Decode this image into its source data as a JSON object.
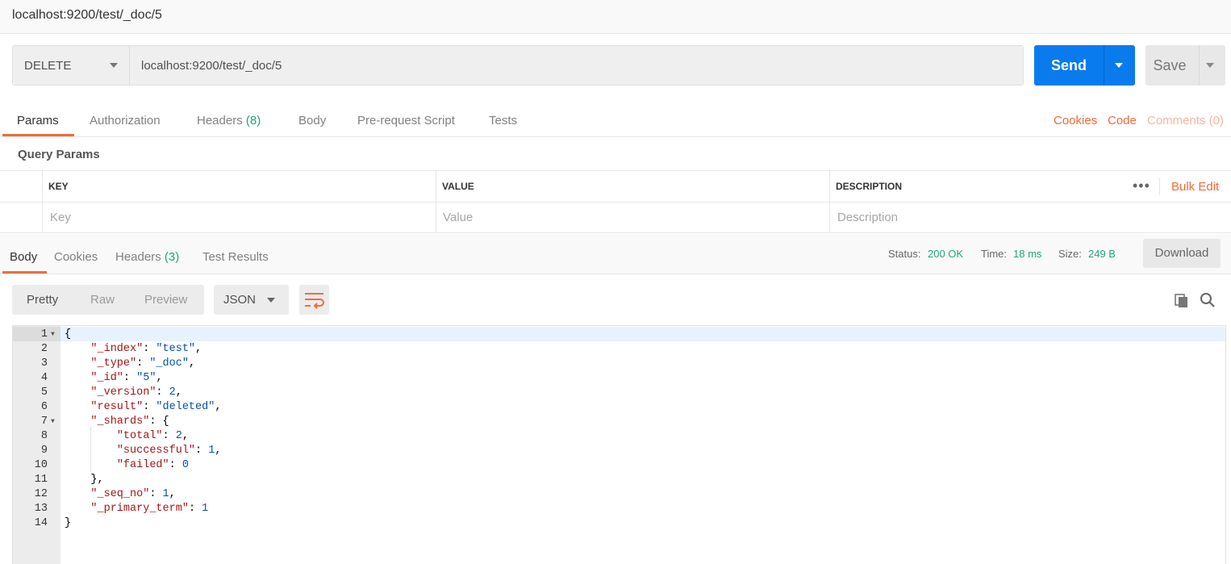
{
  "request": {
    "title": "localhost:9200/test/_doc/5",
    "method": "DELETE",
    "url": "localhost:9200/test/_doc/5",
    "send_label": "Send",
    "save_label": "Save"
  },
  "request_tabs": [
    {
      "label": "Params"
    },
    {
      "label": "Authorization"
    },
    {
      "label": "Headers",
      "count": "(8)"
    },
    {
      "label": "Body"
    },
    {
      "label": "Pre-request Script"
    },
    {
      "label": "Tests"
    }
  ],
  "right_links": {
    "cookies": "Cookies",
    "code": "Code",
    "comments": "Comments (0)"
  },
  "query_params": {
    "title": "Query Params",
    "headers": [
      "KEY",
      "VALUE",
      "DESCRIPTION"
    ],
    "placeholders": {
      "key": "Key",
      "value": "Value",
      "description": "Description"
    },
    "more": "•••",
    "bulk_edit": "Bulk Edit"
  },
  "response": {
    "tabs": [
      {
        "label": "Body"
      },
      {
        "label": "Cookies"
      },
      {
        "label": "Headers",
        "count": "(3)"
      },
      {
        "label": "Test Results"
      }
    ],
    "status_label": "Status:",
    "status_value": "200 OK",
    "time_label": "Time:",
    "time_value": "18 ms",
    "size_label": "Size:",
    "size_value": "249 B",
    "download_label": "Download",
    "view_modes": [
      "Pretty",
      "Raw",
      "Preview"
    ],
    "format": "JSON"
  },
  "code_lines": [
    {
      "n": "1",
      "fold": true,
      "parts": [
        [
          "p",
          "{"
        ]
      ]
    },
    {
      "n": "2",
      "parts": [
        [
          "p",
          "    "
        ],
        [
          "k",
          "\"_index\""
        ],
        [
          "p",
          ": "
        ],
        [
          "s",
          "\"test\""
        ],
        [
          "p",
          ","
        ]
      ]
    },
    {
      "n": "3",
      "parts": [
        [
          "p",
          "    "
        ],
        [
          "k",
          "\"_type\""
        ],
        [
          "p",
          ": "
        ],
        [
          "s",
          "\"_doc\""
        ],
        [
          "p",
          ","
        ]
      ]
    },
    {
      "n": "4",
      "parts": [
        [
          "p",
          "    "
        ],
        [
          "k",
          "\"_id\""
        ],
        [
          "p",
          ": "
        ],
        [
          "s",
          "\"5\""
        ],
        [
          "p",
          ","
        ]
      ]
    },
    {
      "n": "5",
      "parts": [
        [
          "p",
          "    "
        ],
        [
          "k",
          "\"_version\""
        ],
        [
          "p",
          ": "
        ],
        [
          "n",
          "2"
        ],
        [
          "p",
          ","
        ]
      ]
    },
    {
      "n": "6",
      "parts": [
        [
          "p",
          "    "
        ],
        [
          "k",
          "\"result\""
        ],
        [
          "p",
          ": "
        ],
        [
          "s",
          "\"deleted\""
        ],
        [
          "p",
          ","
        ]
      ]
    },
    {
      "n": "7",
      "fold": true,
      "parts": [
        [
          "p",
          "    "
        ],
        [
          "k",
          "\"_shards\""
        ],
        [
          "p",
          ": {"
        ]
      ]
    },
    {
      "n": "8",
      "parts": [
        [
          "p",
          "        "
        ],
        [
          "k",
          "\"total\""
        ],
        [
          "p",
          ": "
        ],
        [
          "n",
          "2"
        ],
        [
          "p",
          ","
        ]
      ]
    },
    {
      "n": "9",
      "parts": [
        [
          "p",
          "        "
        ],
        [
          "k",
          "\"successful\""
        ],
        [
          "p",
          ": "
        ],
        [
          "n",
          "1"
        ],
        [
          "p",
          ","
        ]
      ]
    },
    {
      "n": "10",
      "parts": [
        [
          "p",
          "        "
        ],
        [
          "k",
          "\"failed\""
        ],
        [
          "p",
          ": "
        ],
        [
          "n",
          "0"
        ]
      ]
    },
    {
      "n": "11",
      "parts": [
        [
          "p",
          "    },"
        ]
      ]
    },
    {
      "n": "12",
      "parts": [
        [
          "p",
          "    "
        ],
        [
          "k",
          "\"_seq_no\""
        ],
        [
          "p",
          ": "
        ],
        [
          "n",
          "1"
        ],
        [
          "p",
          ","
        ]
      ]
    },
    {
      "n": "13",
      "parts": [
        [
          "p",
          "    "
        ],
        [
          "k",
          "\"_primary_term\""
        ],
        [
          "p",
          ": "
        ],
        [
          "n",
          "1"
        ]
      ]
    },
    {
      "n": "14",
      "parts": [
        [
          "p",
          "}"
        ]
      ]
    }
  ],
  "colors": {
    "accent": "#f26b3a",
    "send": "#097bed",
    "success": "#1fa67a"
  }
}
